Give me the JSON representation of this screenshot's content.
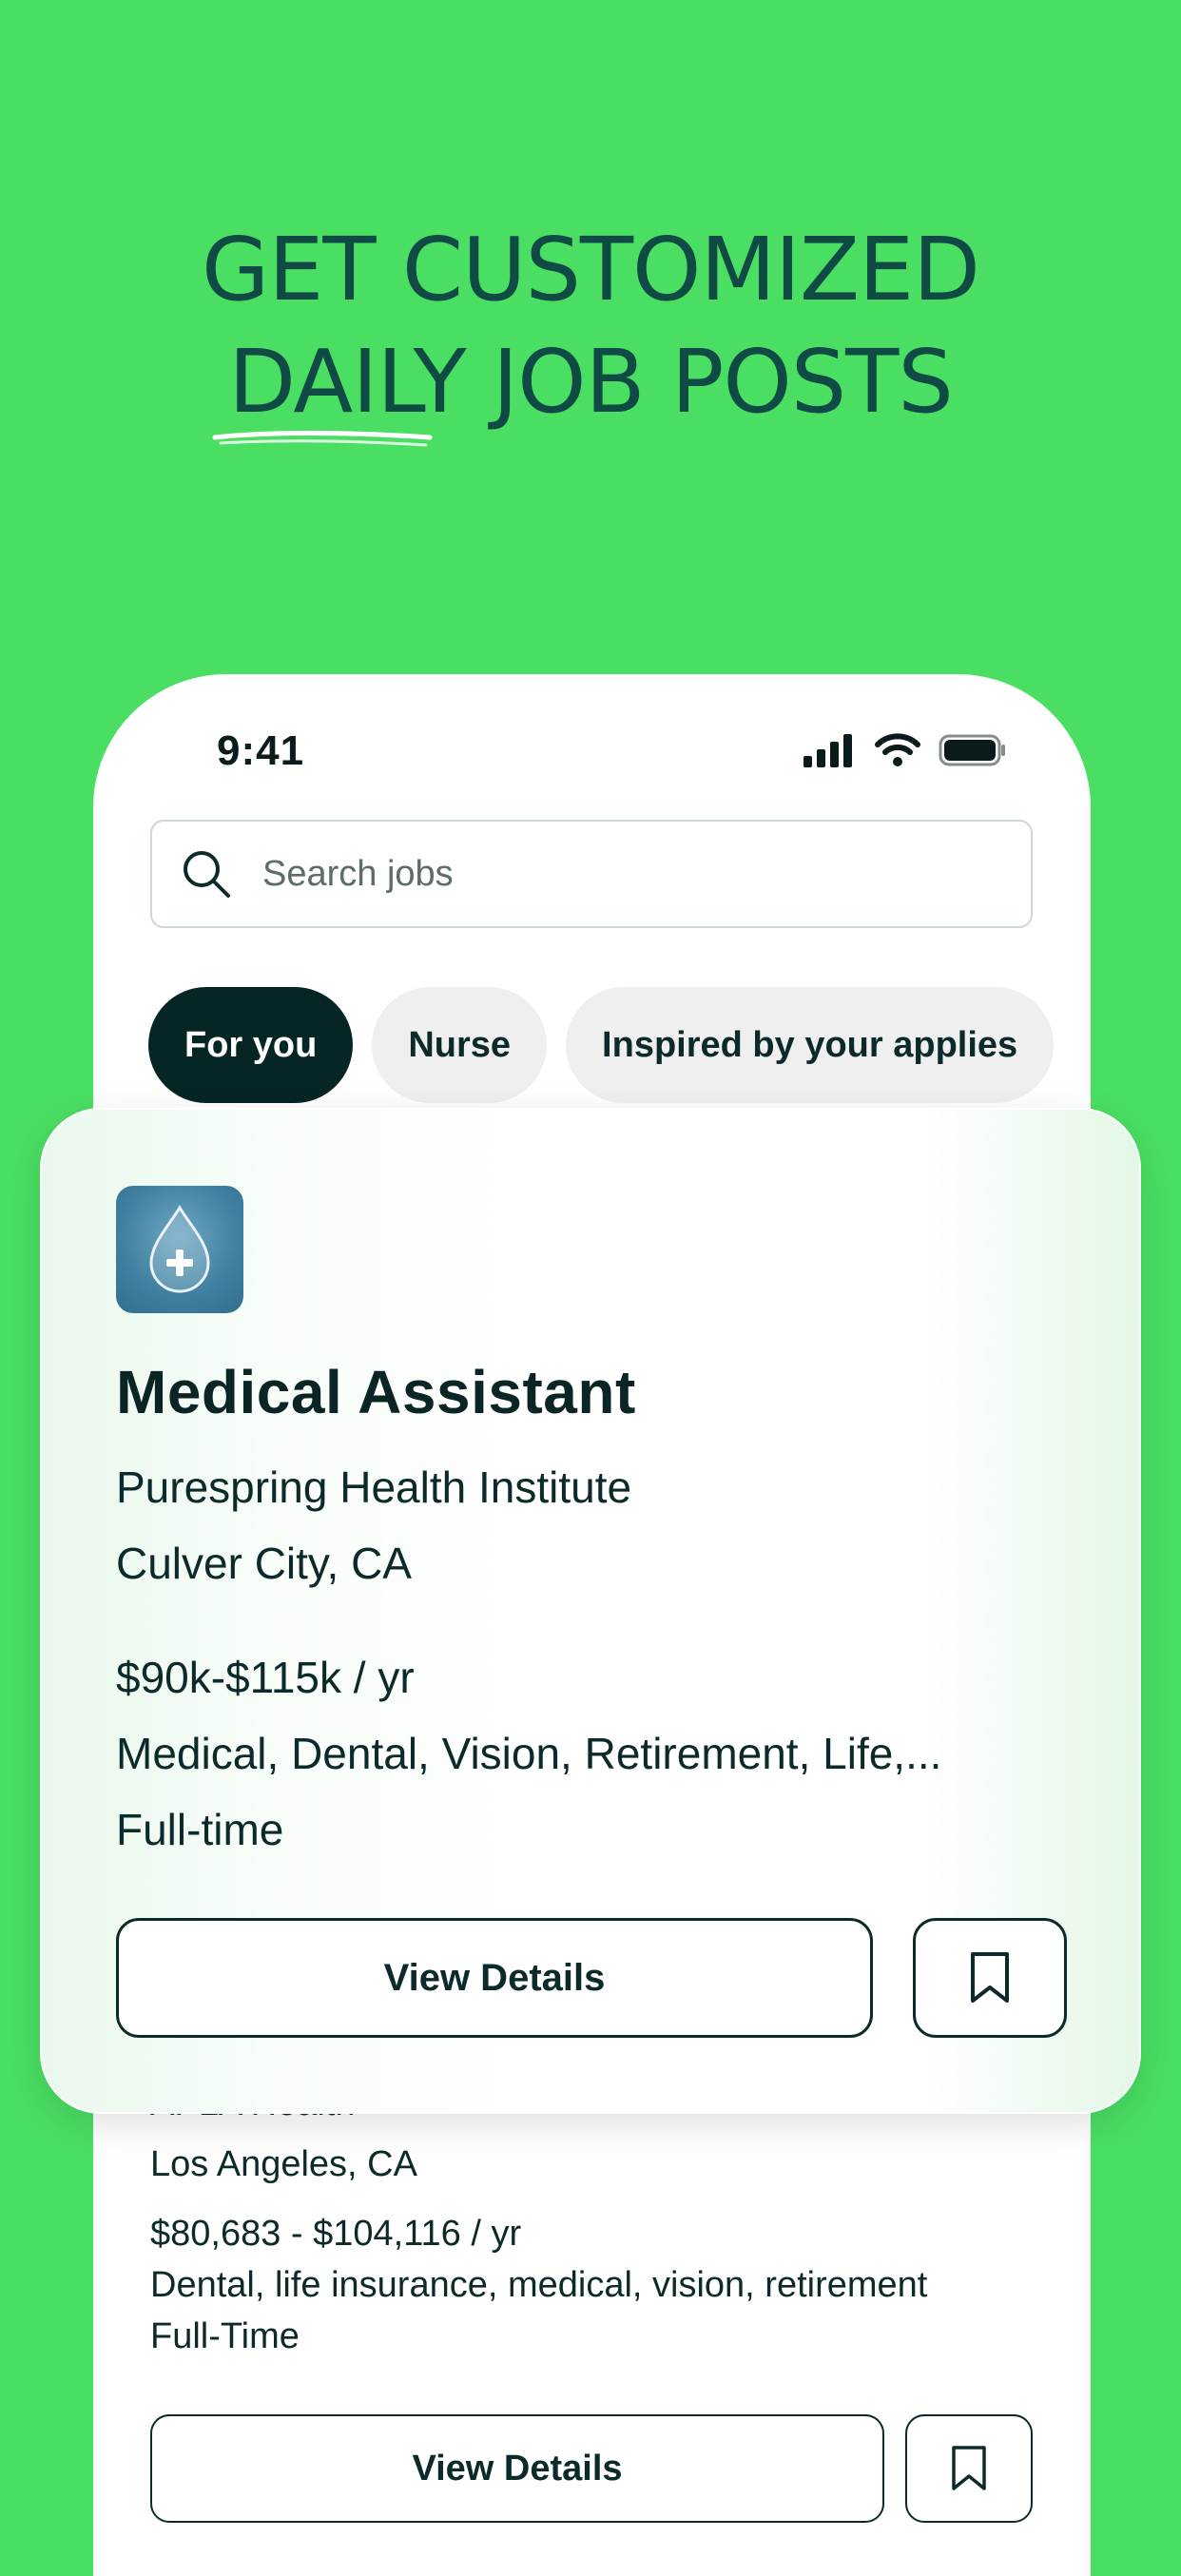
{
  "headline": {
    "line1": "GET CUSTOMIZED",
    "line2": "DAILY JOB POSTS"
  },
  "status_bar": {
    "time": "9:41",
    "icons": [
      "cellular-signal-icon",
      "wifi-icon",
      "battery-icon"
    ]
  },
  "search": {
    "placeholder": "Search jobs",
    "icon": "search-icon"
  },
  "filters": [
    {
      "label": "For you",
      "selected": true
    },
    {
      "label": "Nurse",
      "selected": false
    },
    {
      "label": "Inspired by your applies",
      "selected": false
    }
  ],
  "featured_job": {
    "logo_icon": "drop-plus-icon",
    "title": "Medical Assistant",
    "company": "Purespring Health Institute",
    "location": "Culver City, CA",
    "salary": "$90k-$115k / yr",
    "benefits": "Medical, Dental, Vision, Retirement, Life,...",
    "type": "Full-time",
    "view_details_label": "View Details",
    "bookmark_icon": "bookmark-icon"
  },
  "next_job": {
    "company": "APLA Health",
    "location": "Los Angeles, CA",
    "salary": "$80,683 - $104,116 / yr",
    "benefits": "Dental, life insurance, medical, vision, retirement",
    "type": "Full-Time",
    "view_details_label": "View Details",
    "bookmark_icon": "bookmark-icon"
  },
  "colors": {
    "background": "#4ade63",
    "headline": "#0f4a45",
    "dark": "#062626"
  }
}
